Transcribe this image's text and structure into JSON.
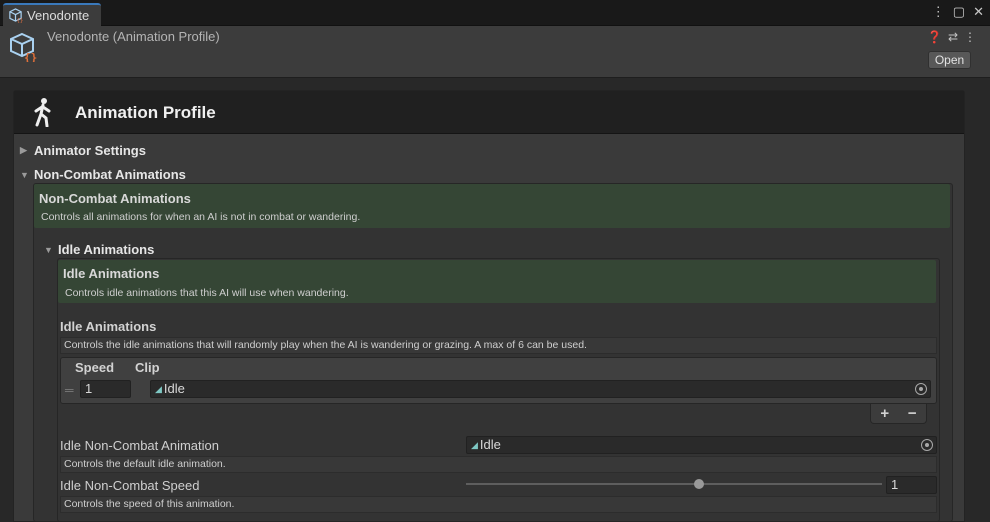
{
  "tab": {
    "label": "Venodonte"
  },
  "header": {
    "title": "Venodonte (Animation Profile)",
    "open_label": "Open"
  },
  "profile": {
    "title": "Animation Profile"
  },
  "foldouts": {
    "animator_settings": "Animator Settings",
    "non_combat": "Non-Combat Animations",
    "idle": "Idle Animations"
  },
  "non_combat_help": {
    "title": "Non-Combat Animations",
    "desc": "Controls all animations for when an AI is not in combat or wandering."
  },
  "idle_help": {
    "title": "Idle Animations",
    "desc": "Controls idle animations that this AI will use when wandering."
  },
  "idle_list": {
    "title": "Idle Animations",
    "desc": "Controls the idle animations that will randomly play when the AI is wandering or grazing. A max of 6 can be used.",
    "columns": [
      "Speed",
      "Clip"
    ],
    "rows": [
      {
        "speed": "1",
        "clip": "Idle"
      }
    ],
    "add": "+",
    "remove": "−"
  },
  "idle_non_combat_animation": {
    "label": "Idle Non-Combat Animation",
    "value": "Idle",
    "desc": "Controls the default idle animation."
  },
  "idle_non_combat_speed": {
    "label": "Idle Non-Combat Speed",
    "value": "1",
    "desc": "Controls the speed of this animation.",
    "slider_fraction": 0.55
  },
  "colors": {
    "accent": "#3a79bb",
    "help_bg": "#354635"
  }
}
